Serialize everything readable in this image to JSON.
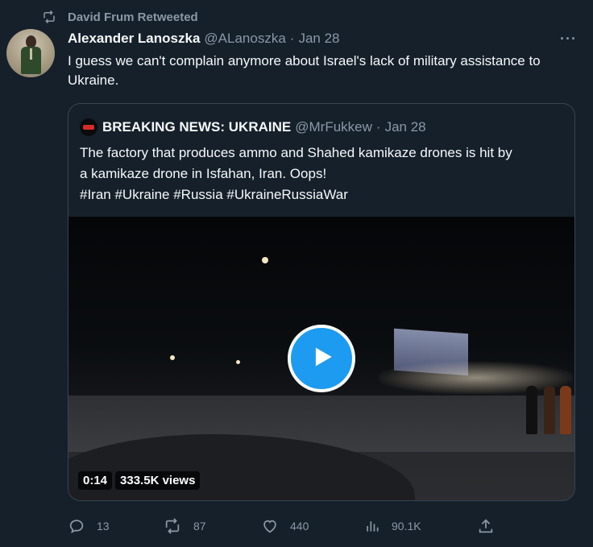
{
  "retweet_context": {
    "text": "David Frum Retweeted"
  },
  "tweet": {
    "author_name": "Alexander Lanoszka",
    "author_handle": "@ALanoszka",
    "separator": "·",
    "date": "Jan 28",
    "text": "I guess we can't complain anymore about Israel's lack of military assistance to Ukraine.",
    "more_label": "···"
  },
  "quoted_tweet": {
    "author_name": "BREAKING NEWS: UKRAINE",
    "author_handle": "@MrFukkew",
    "separator": "·",
    "date": "Jan 28",
    "text_lines": [
      "The factory that produces ammo and Shahed kamikaze drones is hit by",
      "a kamikaze drone in Isfahan, Iran. Oops!",
      "#Iran #Ukraine #Russia #UkraineRussiaWar"
    ],
    "video": {
      "duration": "0:14",
      "views": "333.5K views"
    }
  },
  "actions": {
    "replies": "13",
    "retweets": "87",
    "likes": "440",
    "views": "90.1K"
  },
  "icons": {
    "retweet_context": "retweet-icon",
    "reply": "reply-icon",
    "retweet": "retweet-icon",
    "like": "heart-icon",
    "views": "bar-chart-icon",
    "share": "share-icon",
    "more": "more-icon",
    "play": "play-icon"
  },
  "colors": {
    "accent": "#1d9bf0",
    "background": "#15202b",
    "muted": "#8b98a5",
    "border": "#38444d"
  }
}
